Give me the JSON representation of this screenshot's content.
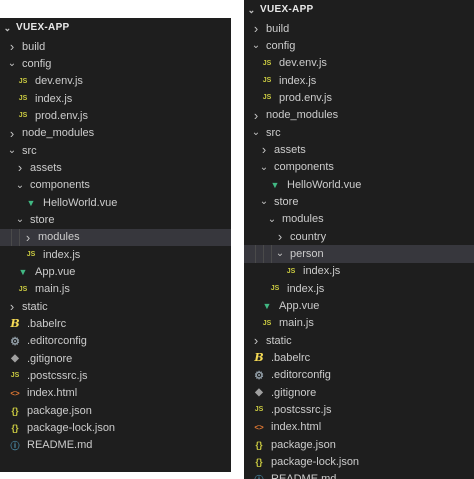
{
  "left": {
    "title": "VUEX-APP",
    "rows": [
      {
        "label": "build",
        "type": "folder",
        "expanded": false,
        "depth": 0,
        "icon": "chevron-right-icon"
      },
      {
        "label": "config",
        "type": "folder",
        "expanded": true,
        "depth": 0,
        "icon": "chevron-down-icon"
      },
      {
        "label": "dev.env.js",
        "type": "js",
        "depth": 1,
        "icon": "js-file-icon"
      },
      {
        "label": "index.js",
        "type": "js",
        "depth": 1,
        "icon": "js-file-icon"
      },
      {
        "label": "prod.env.js",
        "type": "js",
        "depth": 1,
        "icon": "js-file-icon"
      },
      {
        "label": "node_modules",
        "type": "folder",
        "expanded": false,
        "depth": 0,
        "icon": "chevron-right-icon"
      },
      {
        "label": "src",
        "type": "folder",
        "expanded": true,
        "depth": 0,
        "icon": "chevron-down-icon"
      },
      {
        "label": "assets",
        "type": "folder",
        "expanded": false,
        "depth": 1,
        "icon": "chevron-right-icon"
      },
      {
        "label": "components",
        "type": "folder",
        "expanded": true,
        "depth": 1,
        "icon": "chevron-down-icon"
      },
      {
        "label": "HelloWorld.vue",
        "type": "vue",
        "depth": 2,
        "icon": "vue-file-icon"
      },
      {
        "label": "store",
        "type": "folder",
        "expanded": true,
        "depth": 1,
        "icon": "chevron-down-icon"
      },
      {
        "label": "modules",
        "type": "folder",
        "expanded": false,
        "depth": 2,
        "icon": "chevron-right-icon",
        "selected": true
      },
      {
        "label": "index.js",
        "type": "js",
        "depth": 2,
        "icon": "js-file-icon"
      },
      {
        "label": "App.vue",
        "type": "vue",
        "depth": 1,
        "icon": "vue-file-icon"
      },
      {
        "label": "main.js",
        "type": "js",
        "depth": 1,
        "icon": "js-file-icon"
      },
      {
        "label": "static",
        "type": "folder",
        "expanded": false,
        "depth": 0,
        "icon": "chevron-right-icon"
      },
      {
        "label": ".babelrc",
        "type": "babel",
        "depth": 0,
        "icon": "babel-icon"
      },
      {
        "label": ".editorconfig",
        "type": "gear",
        "depth": 0,
        "icon": "gear-icon"
      },
      {
        "label": ".gitignore",
        "type": "git",
        "depth": 0,
        "icon": "git-icon"
      },
      {
        "label": ".postcssrc.js",
        "type": "js",
        "depth": 0,
        "icon": "js-file-icon"
      },
      {
        "label": "index.html",
        "type": "html",
        "depth": 0,
        "icon": "html-file-icon"
      },
      {
        "label": "package.json",
        "type": "json",
        "depth": 0,
        "icon": "json-file-icon"
      },
      {
        "label": "package-lock.json",
        "type": "json",
        "depth": 0,
        "icon": "json-file-icon"
      },
      {
        "label": "README.md",
        "type": "md",
        "depth": 0,
        "icon": "info-icon"
      }
    ]
  },
  "right": {
    "title": "VUEX-APP",
    "rows": [
      {
        "label": "build",
        "type": "folder",
        "expanded": false,
        "depth": 0,
        "icon": "chevron-right-icon"
      },
      {
        "label": "config",
        "type": "folder",
        "expanded": true,
        "depth": 0,
        "icon": "chevron-down-icon"
      },
      {
        "label": "dev.env.js",
        "type": "js",
        "depth": 1,
        "icon": "js-file-icon"
      },
      {
        "label": "index.js",
        "type": "js",
        "depth": 1,
        "icon": "js-file-icon"
      },
      {
        "label": "prod.env.js",
        "type": "js",
        "depth": 1,
        "icon": "js-file-icon"
      },
      {
        "label": "node_modules",
        "type": "folder",
        "expanded": false,
        "depth": 0,
        "icon": "chevron-right-icon"
      },
      {
        "label": "src",
        "type": "folder",
        "expanded": true,
        "depth": 0,
        "icon": "chevron-down-icon"
      },
      {
        "label": "assets",
        "type": "folder",
        "expanded": false,
        "depth": 1,
        "icon": "chevron-right-icon"
      },
      {
        "label": "components",
        "type": "folder",
        "expanded": true,
        "depth": 1,
        "icon": "chevron-down-icon"
      },
      {
        "label": "HelloWorld.vue",
        "type": "vue",
        "depth": 2,
        "icon": "vue-file-icon"
      },
      {
        "label": "store",
        "type": "folder",
        "expanded": true,
        "depth": 1,
        "icon": "chevron-down-icon"
      },
      {
        "label": "modules",
        "type": "folder",
        "expanded": true,
        "depth": 2,
        "icon": "chevron-down-icon"
      },
      {
        "label": "country",
        "type": "folder",
        "expanded": false,
        "depth": 3,
        "icon": "chevron-right-icon"
      },
      {
        "label": "person",
        "type": "folder",
        "expanded": true,
        "depth": 3,
        "icon": "chevron-down-icon",
        "selected": true
      },
      {
        "label": "index.js",
        "type": "js",
        "depth": 4,
        "icon": "js-file-icon"
      },
      {
        "label": "index.js",
        "type": "js",
        "depth": 2,
        "icon": "js-file-icon"
      },
      {
        "label": "App.vue",
        "type": "vue",
        "depth": 1,
        "icon": "vue-file-icon"
      },
      {
        "label": "main.js",
        "type": "js",
        "depth": 1,
        "icon": "js-file-icon"
      },
      {
        "label": "static",
        "type": "folder",
        "expanded": false,
        "depth": 0,
        "icon": "chevron-right-icon"
      },
      {
        "label": ".babelrc",
        "type": "babel",
        "depth": 0,
        "icon": "babel-icon"
      },
      {
        "label": ".editorconfig",
        "type": "gear",
        "depth": 0,
        "icon": "gear-icon"
      },
      {
        "label": ".gitignore",
        "type": "git",
        "depth": 0,
        "icon": "git-icon"
      },
      {
        "label": ".postcssrc.js",
        "type": "js",
        "depth": 0,
        "icon": "js-file-icon"
      },
      {
        "label": "index.html",
        "type": "html",
        "depth": 0,
        "icon": "html-file-icon"
      },
      {
        "label": "package.json",
        "type": "json",
        "depth": 0,
        "icon": "json-file-icon"
      },
      {
        "label": "package-lock.json",
        "type": "json",
        "depth": 0,
        "icon": "json-file-icon"
      },
      {
        "label": "README.md",
        "type": "md",
        "depth": 0,
        "icon": "info-icon"
      }
    ]
  }
}
